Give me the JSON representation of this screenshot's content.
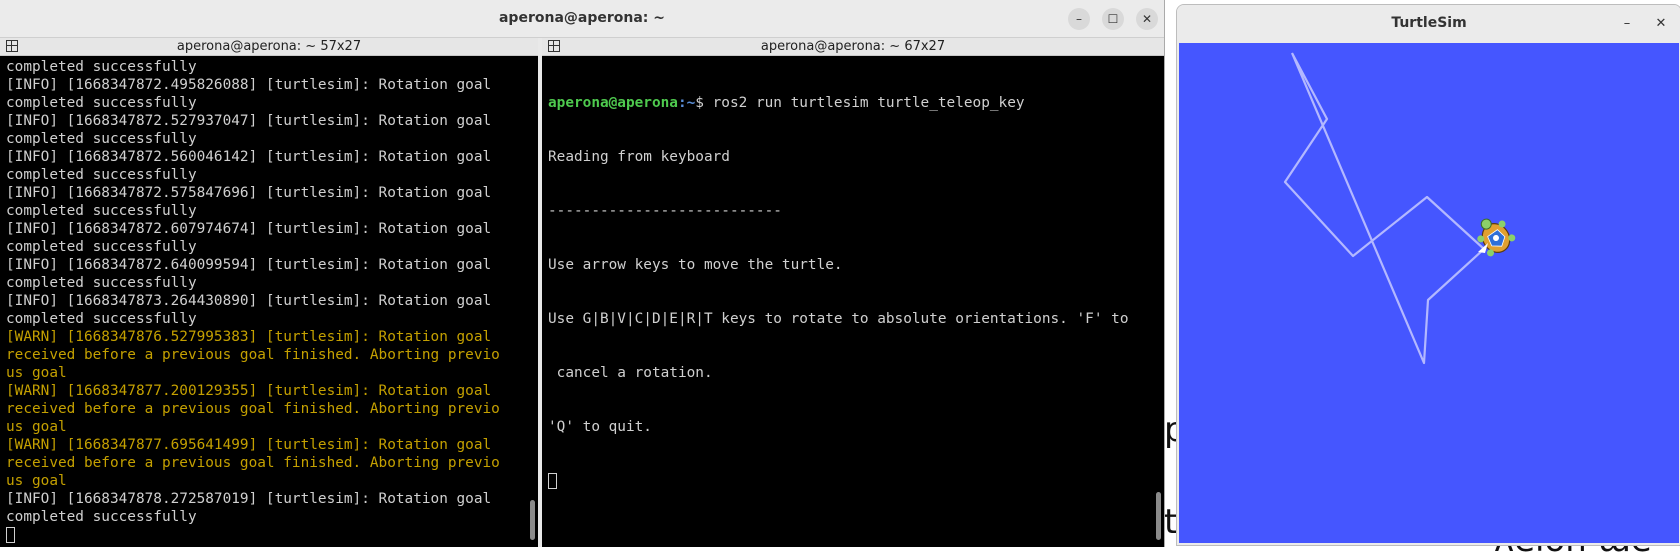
{
  "terminal_window": {
    "title": "aperona@aperona: ~",
    "controls": {
      "minimize": "–",
      "maximize": "☐",
      "close": "✕"
    }
  },
  "left_pane": {
    "title": "aperona@aperona: ~ 57x27",
    "lines": [
      {
        "text": "completed successfully",
        "level": "info"
      },
      {
        "text": "[INFO] [1668347872.495826088] [turtlesim]: Rotation goal",
        "level": "info"
      },
      {
        "text": "completed successfully",
        "level": "info"
      },
      {
        "text": "[INFO] [1668347872.527937047] [turtlesim]: Rotation goal",
        "level": "info"
      },
      {
        "text": "completed successfully",
        "level": "info"
      },
      {
        "text": "[INFO] [1668347872.560046142] [turtlesim]: Rotation goal",
        "level": "info"
      },
      {
        "text": "completed successfully",
        "level": "info"
      },
      {
        "text": "[INFO] [1668347872.575847696] [turtlesim]: Rotation goal",
        "level": "info"
      },
      {
        "text": "completed successfully",
        "level": "info"
      },
      {
        "text": "[INFO] [1668347872.607974674] [turtlesim]: Rotation goal",
        "level": "info"
      },
      {
        "text": "completed successfully",
        "level": "info"
      },
      {
        "text": "[INFO] [1668347872.640099594] [turtlesim]: Rotation goal",
        "level": "info"
      },
      {
        "text": "completed successfully",
        "level": "info"
      },
      {
        "text": "[INFO] [1668347873.264430890] [turtlesim]: Rotation goal",
        "level": "info"
      },
      {
        "text": "completed successfully",
        "level": "info"
      },
      {
        "text": "[WARN] [1668347876.527995383] [turtlesim]: Rotation goal",
        "level": "warn"
      },
      {
        "text": "received before a previous goal finished. Aborting previo",
        "level": "warn"
      },
      {
        "text": "us goal",
        "level": "warn"
      },
      {
        "text": "[WARN] [1668347877.200129355] [turtlesim]: Rotation goal",
        "level": "warn"
      },
      {
        "text": "received before a previous goal finished. Aborting previo",
        "level": "warn"
      },
      {
        "text": "us goal",
        "level": "warn"
      },
      {
        "text": "[WARN] [1668347877.695641499] [turtlesim]: Rotation goal",
        "level": "warn"
      },
      {
        "text": "received before a previous goal finished. Aborting previo",
        "level": "warn"
      },
      {
        "text": "us goal",
        "level": "warn"
      },
      {
        "text": "[INFO] [1668347878.272587019] [turtlesim]: Rotation goal",
        "level": "info"
      },
      {
        "text": "completed successfully",
        "level": "info"
      }
    ]
  },
  "right_pane": {
    "title": "aperona@aperona: ~ 67x27",
    "prompt_user": "aperona@aperona",
    "prompt_path": ":~",
    "prompt_symbol": "$ ",
    "command": "ros2 run turtlesim turtle_teleop_key",
    "lines": [
      "Reading from keyboard",
      "---------------------------",
      "Use arrow keys to move the turtle.",
      "Use G|B|V|C|D|E|R|T keys to rotate to absolute orientations. 'F' to",
      " cancel a rotation.",
      "'Q' to quit."
    ]
  },
  "turtlesim_window": {
    "title": "TurtleSim",
    "controls": {
      "minimize": "–",
      "close": "✕"
    },
    "background_color": "#4556ff",
    "path_color": "#b3b8ff",
    "turtle_icon": "turtle-icon"
  },
  "desktop_background": {
    "glyphs": [
      "pa",
      "tu",
      "ʌelon ɯe"
    ]
  }
}
